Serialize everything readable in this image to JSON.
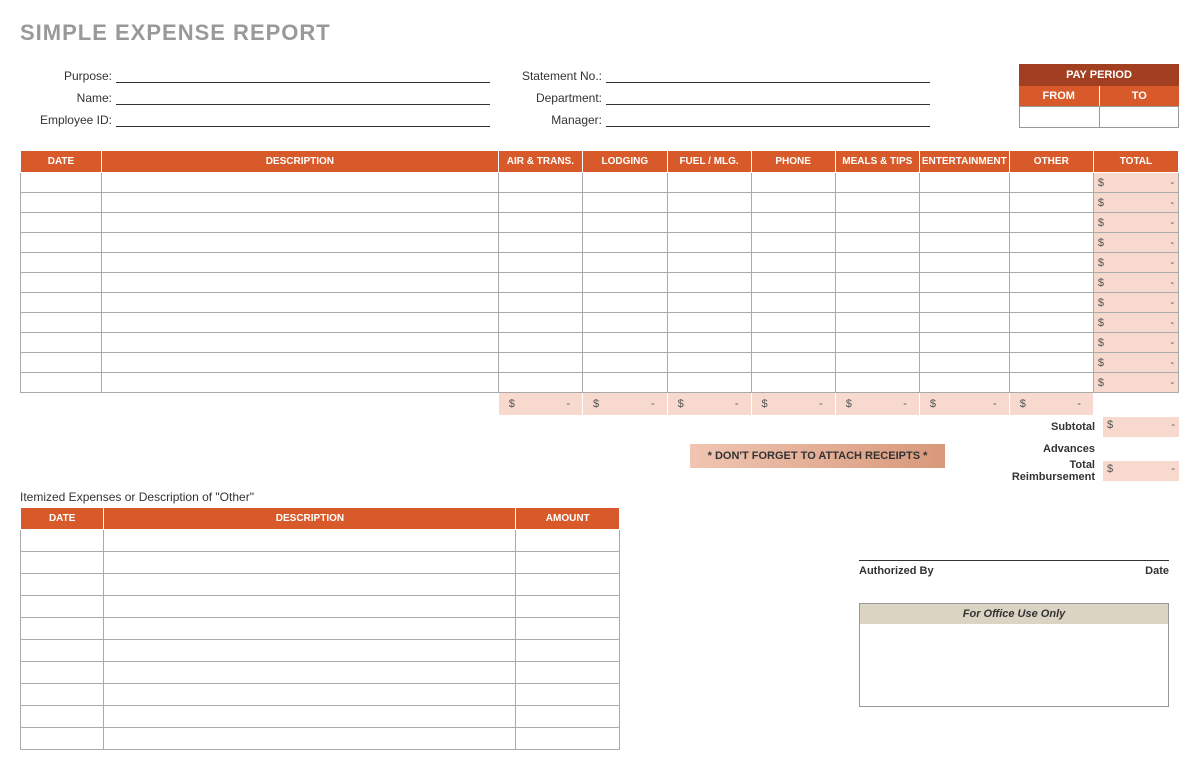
{
  "title": "SIMPLE EXPENSE REPORT",
  "header": {
    "left_labels": [
      "Purpose:",
      "Name:",
      "Employee ID:"
    ],
    "mid_labels": [
      "Statement No.:",
      "Department:",
      "Manager:"
    ]
  },
  "pay_period": {
    "title": "PAY PERIOD",
    "from": "FROM",
    "to": "TO"
  },
  "main_columns": [
    "DATE",
    "DESCRIPTION",
    "AIR & TRANS.",
    "LODGING",
    "FUEL / MLG.",
    "PHONE",
    "MEALS & TIPS",
    "ENTERTAINMENT",
    "OTHER",
    "TOTAL"
  ],
  "total_cell": {
    "symbol": "$",
    "dash": "-"
  },
  "row_count": 11,
  "sum_cell": {
    "symbol": "$",
    "dash": "-"
  },
  "summary": {
    "subtotal_label": "Subtotal",
    "advances_label": "Advances",
    "total_label": "Total Reimbursement",
    "reminder": "* DON'T FORGET TO ATTACH RECEIPTS *"
  },
  "itemized": {
    "title": "Itemized Expenses or Description of \"Other\"",
    "columns": [
      "DATE",
      "DESCRIPTION",
      "AMOUNT"
    ],
    "row_count": 10
  },
  "signature": {
    "auth": "Authorized By",
    "date": "Date"
  },
  "office": {
    "title": "For Office Use Only"
  }
}
